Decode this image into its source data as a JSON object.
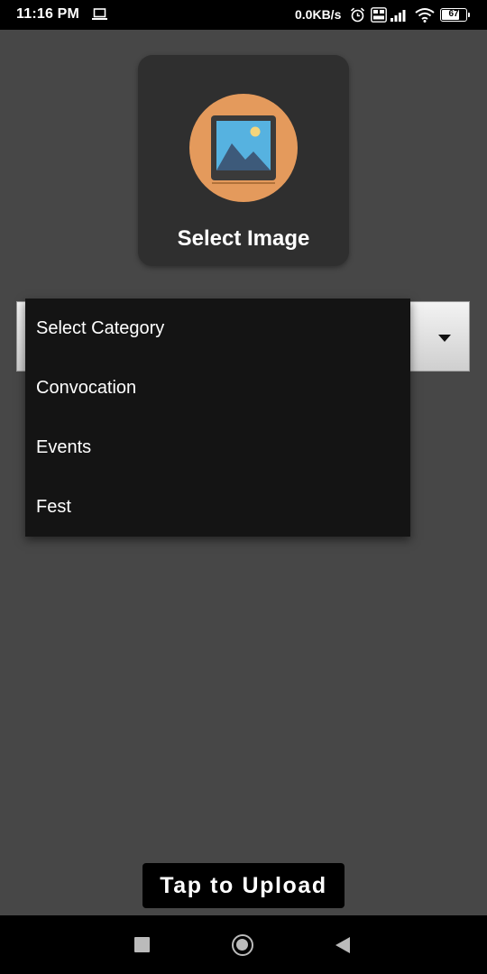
{
  "status_bar": {
    "time": "11:16 PM",
    "net_speed": "0.0KB/s",
    "battery_level": "67",
    "icons": [
      "laptop-icon",
      "alarm-icon",
      "volte-icon",
      "signal-icon",
      "wifi-icon",
      "battery-icon"
    ]
  },
  "image_picker": {
    "label": "Select Image",
    "icon": "image-icon",
    "accent_color": "#e49a5c"
  },
  "category_spinner": {
    "options": [
      "Select Category",
      "Convocation",
      "Events",
      "Fest"
    ]
  },
  "upload_button": {
    "label": "Tap to Upload"
  },
  "nav_bar": {
    "icons": [
      "recents-icon",
      "home-icon",
      "back-icon"
    ]
  }
}
